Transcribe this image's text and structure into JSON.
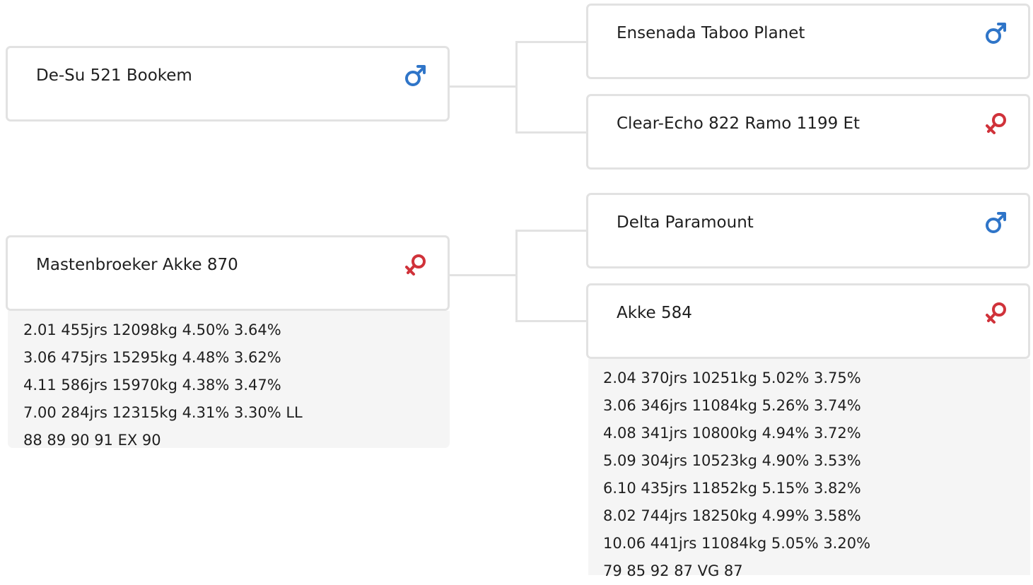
{
  "pedigree": {
    "subject_sire": {
      "name": "De-Su 521 Bookem",
      "sex": "male",
      "sex_icon": "male-icon"
    },
    "subject_dam": {
      "name": "Mastenbroeker Akke 870",
      "sex": "female",
      "sex_icon": "female-icon",
      "details": [
        "2.01 455jrs 12098kg 4.50% 3.64%",
        "3.06 475jrs 15295kg 4.48% 3.62%",
        "4.11 586jrs 15970kg 4.38% 3.47%",
        "7.00 284jrs 12315kg 4.31% 3.30% LL",
        "88 89 90 91 EX 90"
      ]
    },
    "sire_sire": {
      "name": "Ensenada Taboo Planet",
      "sex": "male",
      "sex_icon": "male-icon"
    },
    "sire_dam": {
      "name": "Clear-Echo 822 Ramo 1199 Et",
      "sex": "female",
      "sex_icon": "female-icon"
    },
    "dam_sire": {
      "name": "Delta Paramount",
      "sex": "male",
      "sex_icon": "male-icon"
    },
    "dam_dam": {
      "name": "Akke 584",
      "sex": "female",
      "sex_icon": "female-icon",
      "details": [
        "2.04 370jrs 10251kg 5.02% 3.75%",
        "3.06 346jrs 11084kg 5.26% 3.74%",
        "4.08 341jrs 10800kg 4.94% 3.72%",
        "5.09 304jrs 10523kg 4.90% 3.53%",
        "6.10 435jrs 11852kg 5.15% 3.82%",
        "8.02 744jrs 18250kg 4.99% 3.58%",
        "10.06 441jrs 11084kg 5.05% 3.20%",
        "79 85 92 87 VG 87"
      ]
    }
  },
  "colors": {
    "male": "#2f75c8",
    "female": "#d0323a",
    "card_border": "#e2e2e2",
    "details_bg": "#f5f5f5",
    "connector": "#e2e2e2"
  }
}
